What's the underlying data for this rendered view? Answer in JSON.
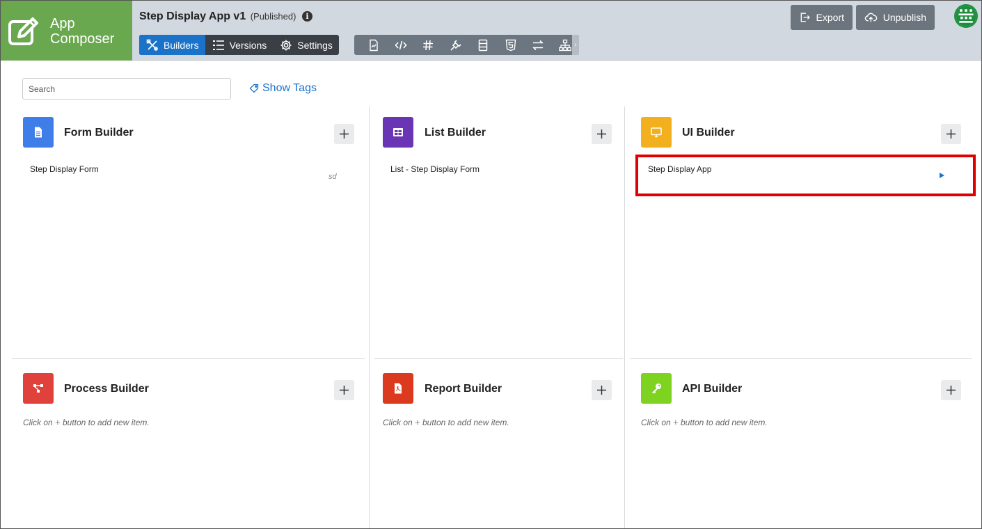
{
  "app": {
    "logo_line1": "App",
    "logo_line2": "Composer",
    "title": "Step Display App v1",
    "status": "(Published)",
    "info_glyph": "i"
  },
  "nav": {
    "builders": "Builders",
    "versions": "Versions",
    "settings": "Settings"
  },
  "tools": [
    "chart-icon",
    "code-icon",
    "hash-icon",
    "plugin-icon",
    "list-icon",
    "html5-icon",
    "arrows-icon",
    "sitemap-icon"
  ],
  "header_actions": {
    "export": "Export",
    "unpublish": "Unpublish"
  },
  "search": {
    "placeholder": "Search",
    "show_tags": "Show Tags"
  },
  "panels": {
    "form": {
      "title": "Form Builder",
      "color": "#3f7ee8",
      "items": [
        {
          "label": "Step Display Form",
          "tag": "sd"
        }
      ]
    },
    "list": {
      "title": "List Builder",
      "color": "#6a35b5",
      "items": [
        {
          "label": "List - Step Display Form"
        }
      ]
    },
    "ui": {
      "title": "UI Builder",
      "color": "#f2b01e",
      "items": [
        {
          "label": "Step Display App"
        }
      ]
    },
    "process": {
      "title": "Process Builder",
      "color": "#e0413a",
      "empty_before": "Click on",
      "empty_plus": "+",
      "empty_after": "button to add new item."
    },
    "report": {
      "title": "Report Builder",
      "color": "#dc3a1e",
      "empty_before": "Click on",
      "empty_plus": "+",
      "empty_after": "button to add new item."
    },
    "api": {
      "title": "API Builder",
      "color": "#7ed321",
      "empty_before": "Click on",
      "empty_plus": "+",
      "empty_after": "button to add new item."
    }
  }
}
